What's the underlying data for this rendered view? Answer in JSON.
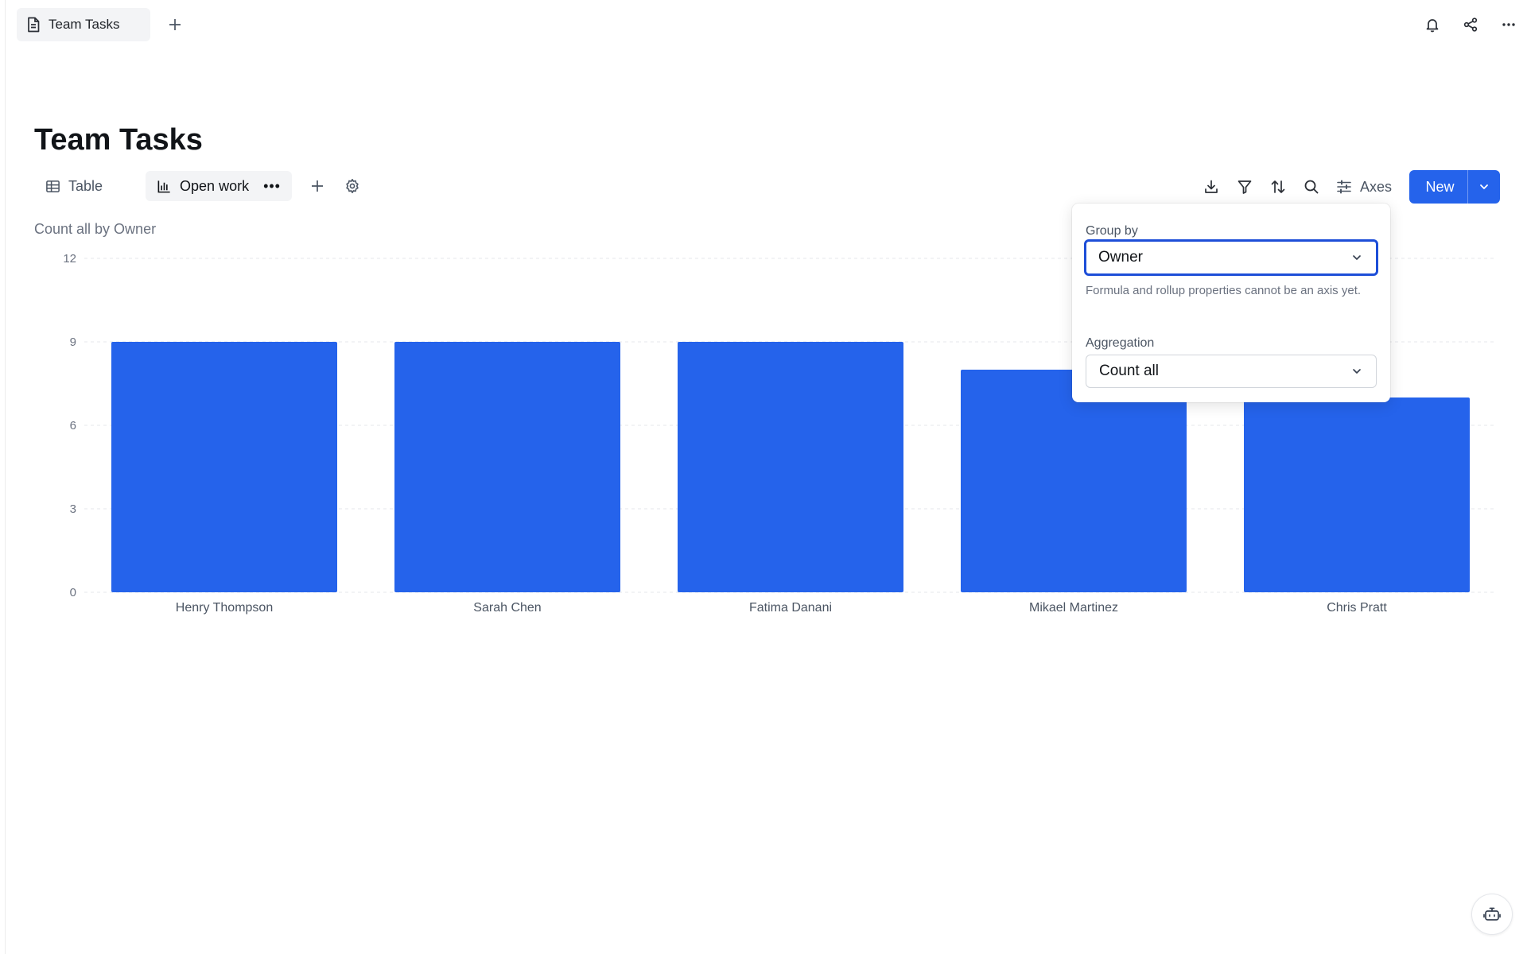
{
  "app": {
    "doc_tab_label": "Team Tasks",
    "page_title": "Team Tasks"
  },
  "views": [
    {
      "label": "Table",
      "icon": "table-icon",
      "active": false
    },
    {
      "label": "Open work",
      "icon": "bar-chart-icon",
      "active": true
    }
  ],
  "toolbar": {
    "axes_label": "Axes",
    "new_label": "New"
  },
  "popover": {
    "group_by_label": "Group by",
    "group_by_value": "Owner",
    "hint": "Formula and rollup properties cannot be an axis yet.",
    "aggregation_label": "Aggregation",
    "aggregation_value": "Count all"
  },
  "chart_data": {
    "type": "bar",
    "title": "Count all by Owner",
    "categories": [
      "Henry Thompson",
      "Sarah Chen",
      "Fatima Danani",
      "Mikael Martinez",
      "Chris Pratt"
    ],
    "values": [
      9,
      9,
      9,
      8,
      7
    ],
    "ylim": [
      0,
      12
    ],
    "yticks": [
      0,
      3,
      6,
      9,
      12
    ],
    "grid": true,
    "bar_color": "#2563eb"
  },
  "colors": {
    "accent": "#2563eb",
    "focus_ring": "#1d4ed8"
  }
}
